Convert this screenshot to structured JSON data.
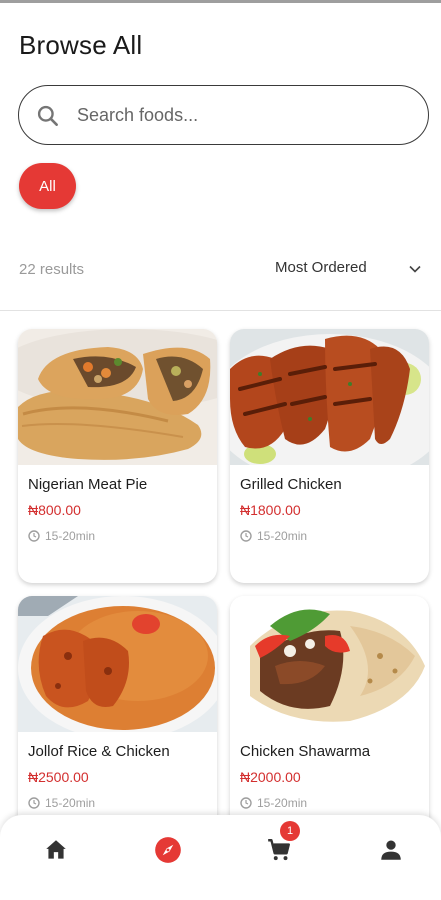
{
  "header": {
    "title": "Browse All"
  },
  "search": {
    "placeholder": "Search foods..."
  },
  "filters": {
    "active_chip": "All"
  },
  "results": {
    "count_text": "22 results",
    "sort_label": "Most Ordered"
  },
  "colors": {
    "accent": "#e53935",
    "price": "#d32f2f",
    "muted": "#9e9e9e"
  },
  "products": [
    {
      "name": "Nigerian Meat Pie",
      "price": "₦800.00",
      "time": "15-20min",
      "image": "meat-pie-image"
    },
    {
      "name": "Grilled Chicken",
      "price": "₦1800.00",
      "time": "15-20min",
      "image": "grilled-chicken-image"
    },
    {
      "name": "Jollof Rice & Chicken",
      "price": "₦2500.00",
      "time": "15-20min",
      "image": "jollof-rice-image"
    },
    {
      "name": "Chicken Shawarma",
      "price": "₦2000.00",
      "time": "15-20min",
      "image": "shawarma-image"
    }
  ],
  "bottom_nav": {
    "items": [
      {
        "icon": "home-icon",
        "active": false
      },
      {
        "icon": "compass-icon",
        "active": true
      },
      {
        "icon": "cart-icon",
        "active": false
      },
      {
        "icon": "person-icon",
        "active": false
      }
    ],
    "cart_badge": "1"
  }
}
